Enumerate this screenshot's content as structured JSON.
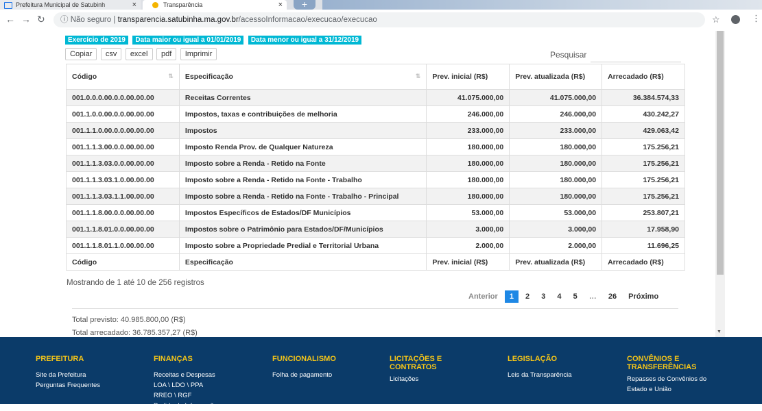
{
  "browser": {
    "tabs": [
      {
        "title": "Prefeitura Municipal de Satubinh"
      },
      {
        "title": "Transparência"
      }
    ],
    "new_tab": "+",
    "close": "×",
    "url_info": "ⓘ Não seguro",
    "url_separator": "|",
    "url_host": "transparencia.satubinha.ma.gov.br",
    "url_path": "/acessoInformacao/execucao/execucao"
  },
  "filters": [
    "Exercício de 2019",
    "Data maior ou igual a 01/01/2019",
    "Data menor ou igual a 31/12/2019"
  ],
  "toolbar": {
    "buttons": [
      "Copiar",
      "csv",
      "excel",
      "pdf",
      "Imprimir"
    ],
    "search_label": "Pesquisar"
  },
  "table": {
    "headers": [
      "Código",
      "Especificação",
      "Prev. inicial (R$)",
      "Prev. atualizada (R$)",
      "Arrecadado (R$)"
    ],
    "rows": [
      [
        "001.0.0.0.00.0.0.00.00.00",
        "Receitas Correntes",
        "41.075.000,00",
        "41.075.000,00",
        "36.384.574,33"
      ],
      [
        "001.1.0.0.00.0.0.00.00.00",
        "Impostos, taxas e contribuições de melhoria",
        "246.000,00",
        "246.000,00",
        "430.242,27"
      ],
      [
        "001.1.1.0.00.0.0.00.00.00",
        "Impostos",
        "233.000,00",
        "233.000,00",
        "429.063,42"
      ],
      [
        "001.1.1.3.00.0.0.00.00.00",
        "Imposto Renda Prov. de Qualquer Natureza",
        "180.000,00",
        "180.000,00",
        "175.256,21"
      ],
      [
        "001.1.1.3.03.0.0.00.00.00",
        "Imposto sobre a Renda - Retido na Fonte",
        "180.000,00",
        "180.000,00",
        "175.256,21"
      ],
      [
        "001.1.1.3.03.1.0.00.00.00",
        "Imposto sobre a Renda - Retido na Fonte - Trabalho",
        "180.000,00",
        "180.000,00",
        "175.256,21"
      ],
      [
        "001.1.1.3.03.1.1.00.00.00",
        "Imposto sobre a Renda - Retido na Fonte - Trabalho - Principal",
        "180.000,00",
        "180.000,00",
        "175.256,21"
      ],
      [
        "001.1.1.8.00.0.0.00.00.00",
        "Impostos Específicos de Estados/DF Municípios",
        "53.000,00",
        "53.000,00",
        "253.807,21"
      ],
      [
        "001.1.1.8.01.0.0.00.00.00",
        "Impostos sobre o Patrimônio para Estados/DF/Municípios",
        "3.000,00",
        "3.000,00",
        "17.958,90"
      ],
      [
        "001.1.1.8.01.1.0.00.00.00",
        "Imposto sobre a Propriedade Predial e Territorial Urbana",
        "2.000,00",
        "2.000,00",
        "11.696,25"
      ]
    ],
    "footer": [
      "Código",
      "Especificação",
      "Prev. inicial (R$)",
      "Prev. atualizada (R$)",
      "Arrecadado (R$)"
    ]
  },
  "info": "Mostrando de 1 até 10 de 256 registros",
  "pagination": {
    "prev": "Anterior",
    "pages": [
      "1",
      "2",
      "3",
      "4",
      "5"
    ],
    "ellipsis": "…",
    "last": "26",
    "next": "Próximo",
    "active": "1"
  },
  "totals": {
    "previsto": "Total previsto: 40.985.800,00 (R$)",
    "arrecadado": "Total arrecadado: 36.785.357,27 (R$)"
  },
  "footer": {
    "columns": [
      {
        "title": "PREFEITURA",
        "links": [
          "Site da Prefeitura",
          "Perguntas Frequentes"
        ]
      },
      {
        "title": "FINANÇAS",
        "links": [
          "Receitas e Despesas",
          "LOA \\ LDO \\ PPA",
          "RREO \\ RGF",
          "Pedido de Informações"
        ]
      },
      {
        "title": "FUNCIONALISMO",
        "links": [
          "Folha de pagamento"
        ]
      },
      {
        "title": "LICITAÇÕES E CONTRATOS",
        "links": [
          "Licitações"
        ]
      },
      {
        "title": "LEGISLAÇÃO",
        "links": [
          "Leis da Transparência"
        ]
      },
      {
        "title": "CONVÊNIOS E TRANSFERÊNCIAS",
        "links": [
          "Repasses de Convênios do Estado e União"
        ]
      }
    ]
  },
  "colors": {
    "accent": "#00b8d4",
    "pager_active": "#1e88e5",
    "footer_bg": "#0b3b69",
    "footer_heading": "#f5c518"
  }
}
